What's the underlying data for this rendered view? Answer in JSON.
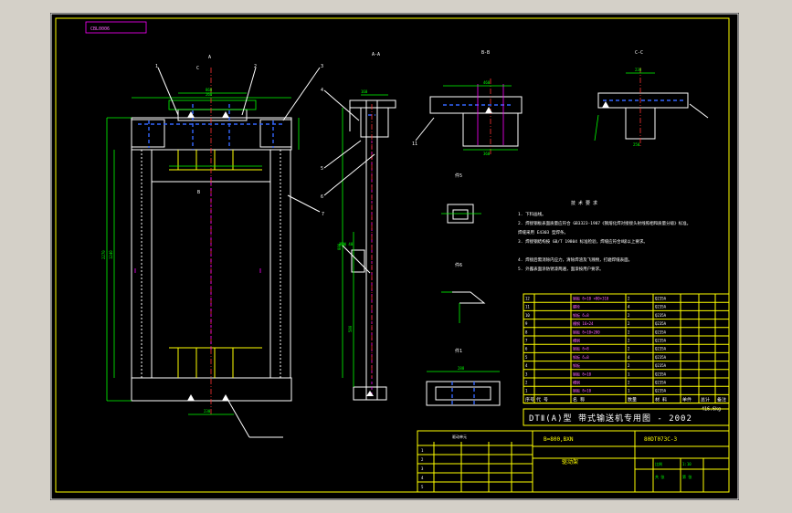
{
  "drawing_code": "CBL0006",
  "section_labels": {
    "aa": "A-A",
    "bb": "B-B",
    "cc": "C-C",
    "detail5": "件5",
    "detail6": "件6",
    "detail1": "件1",
    "c_top": "C",
    "b_mid": "B",
    "a_top": "A"
  },
  "callouts": [
    "1",
    "2",
    "3",
    "4",
    "5",
    "6",
    "7",
    "11"
  ],
  "tech_requirements": {
    "title": "技 术 要 求",
    "lines": [
      "1. 下料画线。",
      "2. 焊接钢板表面质量应符合 GB3323-1987《钢熔化焊对接接头射线照相和质量分级》标准。",
      "   焊缝采用 E4303 型焊条。",
      "3. 焊接钢结构按 GB/T 19804 标准检验，焊缝应符合Ⅱ级以上要求。",
      "4. 焊接后需消除内应力，清除焊渣及飞溅物，打磨焊缝表面。",
      "5. 外露表面涂防锈漆两遍，面漆按用户要求。"
    ]
  },
  "title_block": {
    "product": "DTⅡ(A)型  带式输送机专用图 - 2002",
    "spec": "B=800,BXN",
    "drawing_no": "80DT073C-3",
    "part_name": "驱动架",
    "weight": "416.6kg",
    "header_cols": [
      "序号",
      "代 号",
      "名 称",
      "数量",
      "材 料",
      "单件",
      "总计",
      "备注"
    ],
    "parts_rows": [
      [
        "12",
        "",
        "钢板 δ=10 ×80×310",
        "2",
        "Q235A",
        "",
        "",
        ""
      ],
      [
        "11",
        "",
        "螺栓",
        "4",
        "Q235A",
        "",
        "",
        ""
      ],
      [
        "10",
        "",
        "钢板 δ=8",
        "2",
        "Q235A",
        "",
        "",
        ""
      ],
      [
        "9",
        "",
        "槽钢 16×24",
        "2",
        "Q235A",
        "",
        "",
        ""
      ],
      [
        "8",
        "",
        "钢板 δ=10×280",
        "2",
        "Q235A",
        "",
        "",
        ""
      ],
      [
        "7",
        "",
        "槽钢",
        "2",
        "Q235A",
        "",
        "",
        ""
      ],
      [
        "6",
        "",
        "钢板 δ=8",
        "2",
        "Q235A",
        "",
        "",
        ""
      ],
      [
        "5",
        "",
        "钢板 δ=8",
        "4",
        "Q235A",
        "",
        "",
        ""
      ],
      [
        "4",
        "",
        "钢板",
        "2",
        "Q235A",
        "",
        "",
        ""
      ],
      [
        "3",
        "",
        "钢板 δ=10",
        "1",
        "Q235A",
        "",
        "",
        ""
      ],
      [
        "2",
        "",
        "槽钢",
        "2",
        "Q235A",
        "",
        "",
        ""
      ],
      [
        "1",
        "",
        "钢板 δ=10",
        "1",
        "Q235A",
        "",
        "",
        ""
      ]
    ],
    "change_block_title": "驱动单元",
    "change_rows": [
      [
        "1",
        "",
        "",
        "",
        "",
        "",
        ""
      ],
      [
        "2",
        "",
        "",
        "",
        "",
        "",
        ""
      ],
      [
        "3",
        "",
        "",
        "",
        "",
        "",
        ""
      ],
      [
        "4",
        "",
        "",
        "",
        "",
        "",
        ""
      ],
      [
        "5",
        "",
        "",
        "",
        "",
        "",
        ""
      ]
    ],
    "right_cells": [
      "比例",
      "1:10",
      "共 张",
      "第 张"
    ]
  },
  "dims": {
    "front_width": "860",
    "front_inner": "260",
    "front_height": "2270",
    "front_left": "1240",
    "bottom_span": "230",
    "aa_top": "160",
    "aa_height": "880",
    "aa_lower": "580",
    "bb_width": "360",
    "bb_top": "460",
    "cc_top": "230",
    "cc_width": "250",
    "d1_width": "288",
    "note_15": "两端 40",
    "ratio": "1:10"
  }
}
